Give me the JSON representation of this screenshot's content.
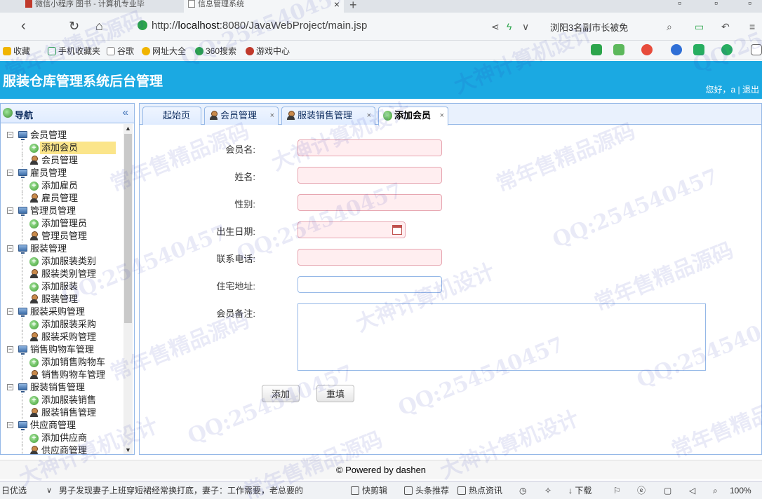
{
  "browser": {
    "tabs": [
      {
        "label": "微信小程序 图书 - 计算机专业毕"
      },
      {
        "label": "信息管理系统"
      }
    ],
    "url_prefix": "http://",
    "url_host": "localhost",
    "url_rest": ":8080/JavaWebProject/main.jsp",
    "news_snippet": "浏阳3名副市长被免",
    "bookmarks": [
      "收藏",
      "手机收藏夹",
      "谷歌",
      "网址大全",
      "360搜索",
      "游戏中心"
    ]
  },
  "header": {
    "title": "服装仓库管理系统后台管理",
    "greeting": "您好，a",
    "separator": "|",
    "logout": "退出"
  },
  "nav": {
    "title": "导航",
    "collapse_glyph": "«",
    "rows": [
      {
        "type": "group",
        "label": "会员管理"
      },
      {
        "type": "item",
        "icon": "add",
        "label": "添加会员",
        "selected": true
      },
      {
        "type": "item",
        "icon": "person",
        "label": "会员管理"
      },
      {
        "type": "group",
        "label": "雇员管理"
      },
      {
        "type": "item",
        "icon": "add",
        "label": "添加雇员"
      },
      {
        "type": "item",
        "icon": "person",
        "label": "雇员管理"
      },
      {
        "type": "group",
        "label": "管理员管理"
      },
      {
        "type": "item",
        "icon": "add",
        "label": "添加管理员"
      },
      {
        "type": "item",
        "icon": "person",
        "label": "管理员管理"
      },
      {
        "type": "group",
        "label": "服装管理"
      },
      {
        "type": "item",
        "icon": "add",
        "label": "添加服装类别"
      },
      {
        "type": "item",
        "icon": "person",
        "label": "服装类别管理"
      },
      {
        "type": "item",
        "icon": "add",
        "label": "添加服装"
      },
      {
        "type": "item",
        "icon": "person",
        "label": "服装管理"
      },
      {
        "type": "group",
        "label": "服装采购管理"
      },
      {
        "type": "item",
        "icon": "add",
        "label": "添加服装采购"
      },
      {
        "type": "item",
        "icon": "person",
        "label": "服装采购管理"
      },
      {
        "type": "group",
        "label": "销售购物车管理"
      },
      {
        "type": "item",
        "icon": "add",
        "label": "添加销售购物车"
      },
      {
        "type": "item",
        "icon": "person",
        "label": "销售购物车管理"
      },
      {
        "type": "group",
        "label": "服装销售管理"
      },
      {
        "type": "item",
        "icon": "add",
        "label": "添加服装销售"
      },
      {
        "type": "item",
        "icon": "person",
        "label": "服装销售管理"
      },
      {
        "type": "group",
        "label": "供应商管理"
      },
      {
        "type": "item",
        "icon": "add",
        "label": "添加供应商"
      },
      {
        "type": "item",
        "icon": "person",
        "label": "供应商管理"
      }
    ]
  },
  "tabs": [
    {
      "label": "起始页",
      "icon": "none",
      "closable": false,
      "active": false
    },
    {
      "label": "会员管理",
      "icon": "person",
      "closable": true,
      "active": false
    },
    {
      "label": "服装销售管理",
      "icon": "person",
      "closable": true,
      "active": false
    },
    {
      "label": "添加会员",
      "icon": "add",
      "closable": true,
      "active": true
    }
  ],
  "form": {
    "labels": {
      "username": "会员名:",
      "realname": "姓名:",
      "gender": "性别:",
      "birthday": "出生日期:",
      "phone": "联系电话:",
      "address": "住宅地址:",
      "memo": "会员备注:"
    },
    "values": {
      "username": "",
      "realname": "",
      "gender": "",
      "birthday": "",
      "phone": "",
      "address": "",
      "memo": ""
    },
    "add_button": "添加",
    "reset_button": "重填"
  },
  "footer": {
    "text": "© Powered by dashen"
  },
  "statusbar": {
    "left": "日优选",
    "news": "男子发现妻子上班穿短裙经常换打底，妻子：工作需要，老总要的",
    "items": [
      "快剪辑",
      "头条推荐",
      "热点资讯",
      "下载"
    ],
    "zoom": "100%"
  },
  "watermarks": [
    "常年售精品源码",
    "QQ:254540457",
    "大神计算机设计"
  ]
}
